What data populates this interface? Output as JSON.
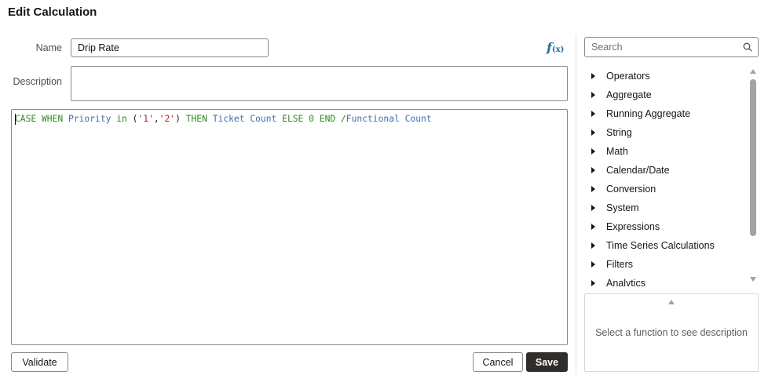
{
  "dialog": {
    "title": "Edit Calculation"
  },
  "form": {
    "name_label": "Name",
    "name_value": "Drip Rate",
    "description_label": "Description",
    "description_value": "",
    "function_button_icon": "fx-function-icon",
    "function_button_text": "f",
    "function_button_sub": "(x)"
  },
  "editor": {
    "tokens": [
      {
        "type": "kw",
        "text": "CASE WHEN "
      },
      {
        "type": "col",
        "text": "Priority"
      },
      {
        "type": "kw",
        "text": " in "
      },
      {
        "type": "punc",
        "text": "("
      },
      {
        "type": "str",
        "text": "'1'"
      },
      {
        "type": "punc",
        "text": ","
      },
      {
        "type": "str",
        "text": "'2'"
      },
      {
        "type": "punc",
        "text": ") "
      },
      {
        "type": "kw",
        "text": "THEN "
      },
      {
        "type": "col",
        "text": "Ticket Count"
      },
      {
        "type": "kw",
        "text": " ELSE "
      },
      {
        "type": "num",
        "text": "0"
      },
      {
        "type": "kw",
        "text": " END "
      },
      {
        "type": "op",
        "text": "/"
      },
      {
        "type": "col",
        "text": "Functional Count"
      }
    ]
  },
  "buttons": {
    "validate": "Validate",
    "cancel": "Cancel",
    "save": "Save"
  },
  "function_panel": {
    "search_placeholder": "Search",
    "search_icon": "search-icon",
    "categories": [
      "Operators",
      "Aggregate",
      "Running Aggregate",
      "String",
      "Math",
      "Calendar/Date",
      "Conversion",
      "System",
      "Expressions",
      "Time Series Calculations",
      "Filters",
      "Analytics"
    ],
    "description_placeholder": "Select a function to see description"
  },
  "colors": {
    "keyword": "#2e8b23",
    "column": "#3a6fae",
    "string": "#b5261e",
    "fx_icon": "#227093",
    "save_button": "#312d2a"
  }
}
